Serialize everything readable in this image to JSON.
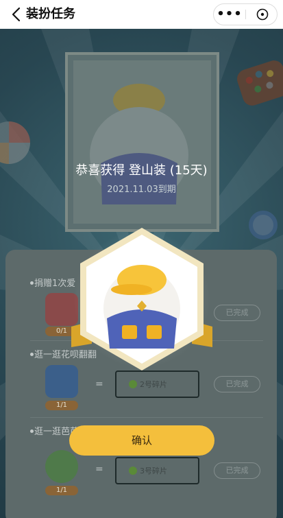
{
  "nav": {
    "title": "装扮任务",
    "more_label": "•••"
  },
  "reward": {
    "title": "恭喜获得 登山装 (15天)",
    "expire": "2021.11.03到期",
    "confirm_label": "确认"
  },
  "tasks": [
    {
      "title": "捐赠1次爱",
      "count": "0/1",
      "piece": "",
      "status": "已完成"
    },
    {
      "title": "逛一逛花呗翻翻",
      "count": "1/1",
      "piece": "2号碎片",
      "status": "已完成"
    },
    {
      "title": "逛一逛芭芭农场",
      "count": "1/1",
      "piece": "3号碎片",
      "status": "已完成"
    }
  ],
  "colors": {
    "accent": "#f4bf3c",
    "overlay": "#2a4a55",
    "hex_border": "#f2e6c0"
  }
}
